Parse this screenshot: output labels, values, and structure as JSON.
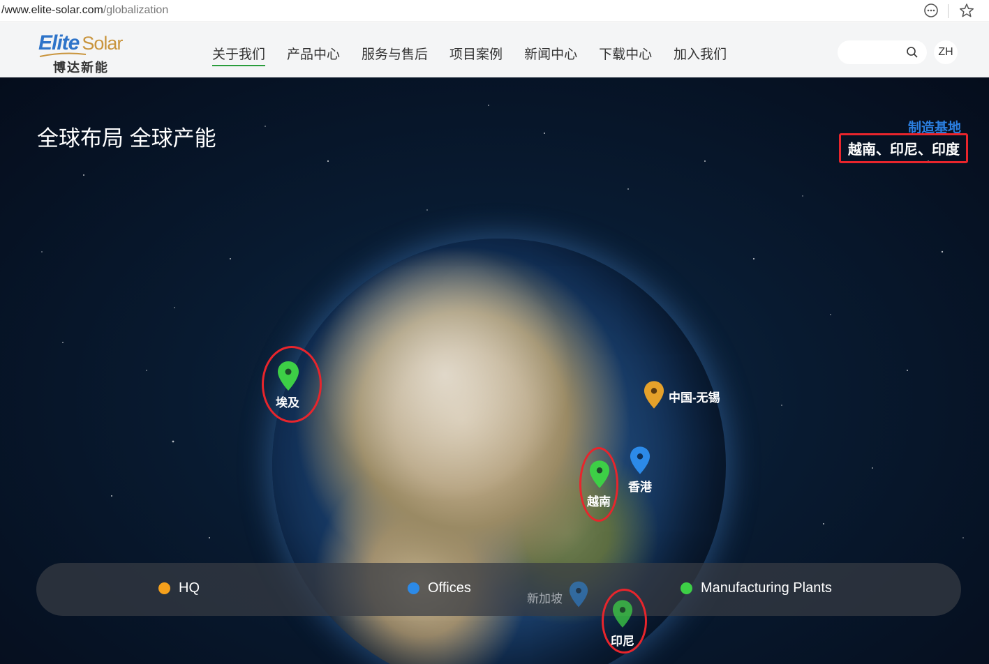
{
  "browser": {
    "url_host": "/www.elite-solar.com",
    "url_path": "/globalization"
  },
  "logo": {
    "brand_en_1": "Elite",
    "brand_en_2": "Solar",
    "brand_cn": "博达新能"
  },
  "nav": {
    "items": [
      "关于我们",
      "产品中心",
      "服务与售后",
      "项目案例",
      "新闻中心",
      "下载中心",
      "加入我们"
    ],
    "active_index": 0
  },
  "header": {
    "search_placeholder": "",
    "lang_label": "ZH"
  },
  "hero": {
    "title": "全球布局 全球产能",
    "side_label": "制造基地",
    "side_value": "越南、印尼、印度"
  },
  "pins": {
    "egypt": "埃及",
    "wuxi": "中国-无锡",
    "hongkong": "香港",
    "vietnam": "越南",
    "singapore": "新加坡",
    "indonesia": "印尼"
  },
  "legend": {
    "hq": "HQ",
    "offices": "Offices",
    "plants": "Manufacturing Plants"
  },
  "colors": {
    "hq": "#f5a01c",
    "office": "#2c8ae8",
    "plant": "#3dcf46",
    "accent_nav": "#2a9d3c",
    "highlight": "#e8252c",
    "side_label": "#2b7fe0"
  }
}
